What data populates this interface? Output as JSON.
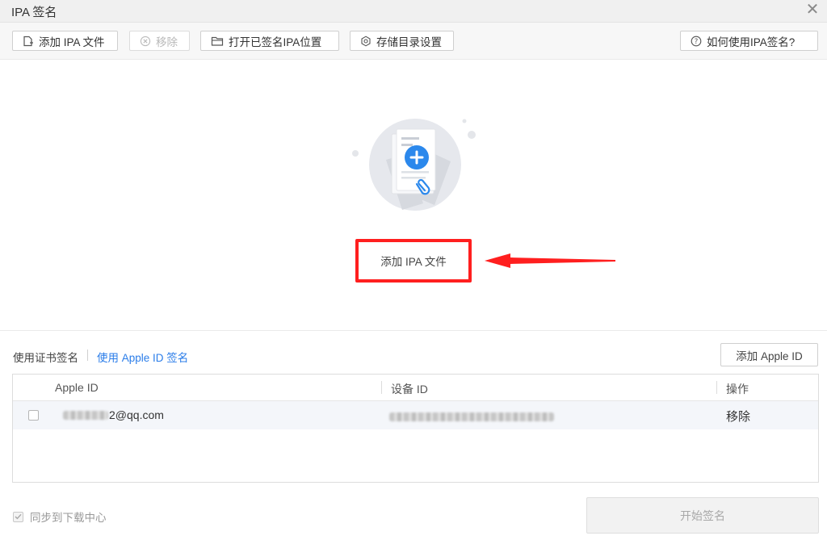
{
  "window": {
    "title": "IPA 签名"
  },
  "toolbar": {
    "add_ipa": "添加 IPA 文件",
    "remove": "移除",
    "open_signed": "打开已签名IPA位置",
    "storage_settings": "存储目录设置",
    "help": "如何使用IPA签名?"
  },
  "dropzone": {
    "add_button": "添加 IPA 文件"
  },
  "sign_mode": {
    "tabs": [
      "使用证书签名",
      "使用 Apple ID 签名"
    ],
    "active_tab": "使用 Apple ID 签名",
    "add_apple_id": "添加 Apple ID"
  },
  "table": {
    "columns": [
      "Apple ID",
      "设备 ID",
      "操作"
    ],
    "rows": [
      {
        "apple_id_visible": "2@qq.com",
        "apple_id_redacted": true,
        "device_id_redacted": true,
        "action": "移除",
        "checked": false
      }
    ]
  },
  "footer": {
    "sync_label": "同步到下载中心",
    "sync_checked": true,
    "sync_disabled": true,
    "start_button": "开始签名",
    "start_disabled": true
  },
  "colors": {
    "accent": "#2b7de9",
    "highlight": "#ff1f1f",
    "illustration_plus": "#2b88ec"
  }
}
